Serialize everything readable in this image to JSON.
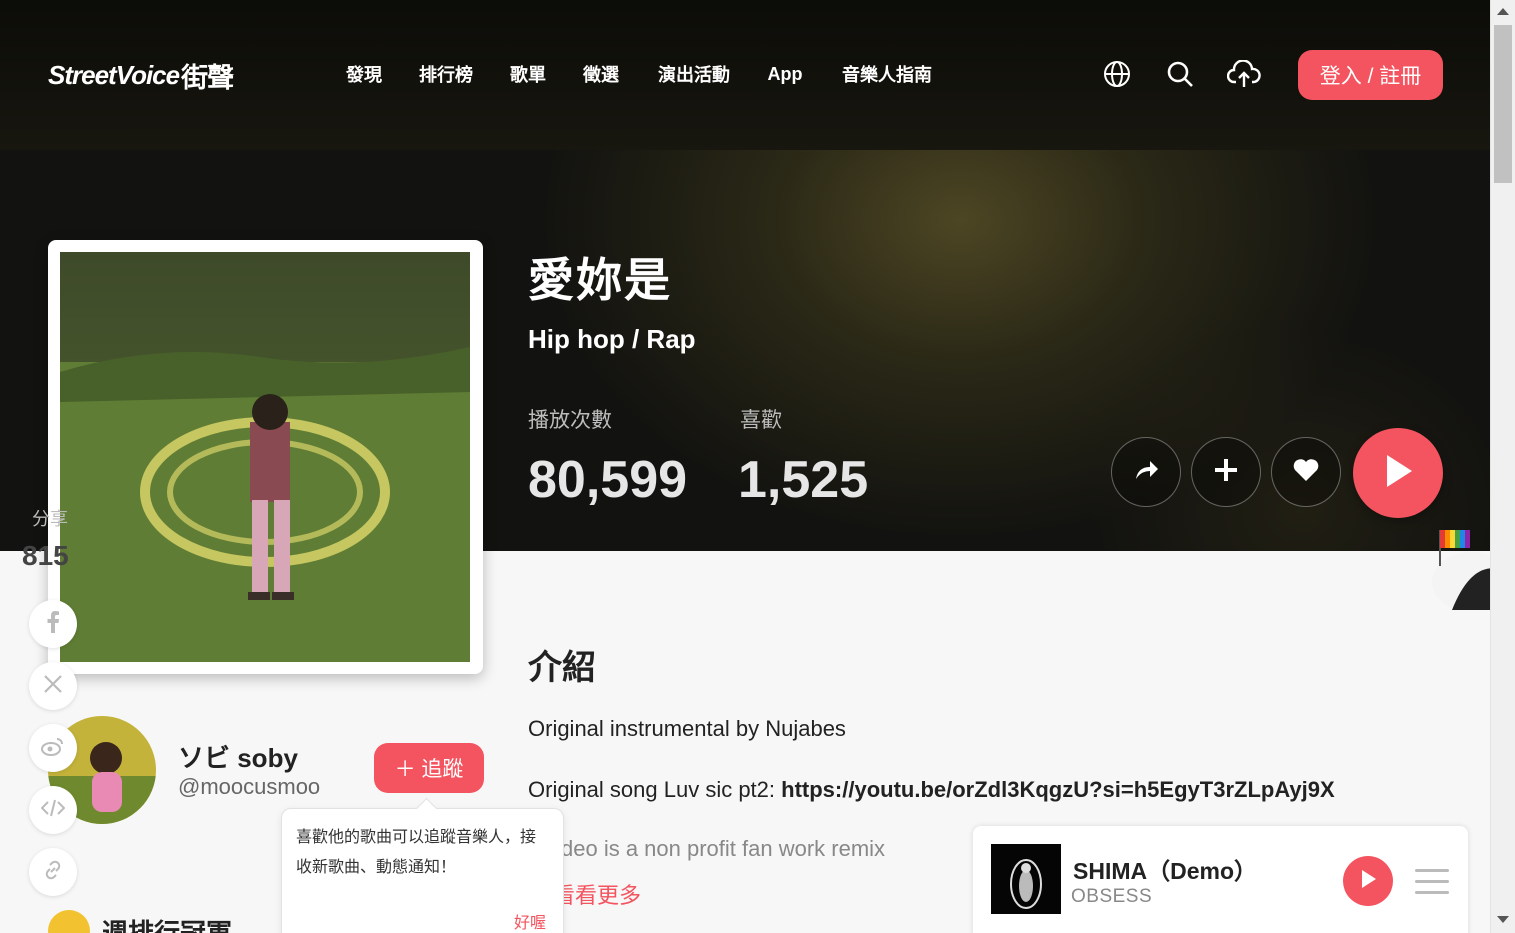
{
  "nav": {
    "logo_text": "StreetVoice",
    "logo_zh": "街聲",
    "items": [
      {
        "label": "發現"
      },
      {
        "label": "排行榜"
      },
      {
        "label": "歌單"
      },
      {
        "label": "徵選"
      },
      {
        "label": "演出活動"
      },
      {
        "label": "App"
      },
      {
        "label": "音樂人指南"
      }
    ],
    "icons": [
      "globe-icon",
      "search-icon",
      "upload-cloud-icon"
    ],
    "login_label": "登入 / 註冊"
  },
  "song": {
    "title": "愛妳是",
    "genre": "Hip hop / Rap",
    "plays_label": "播放次數",
    "plays_value": "80,599",
    "likes_label": "喜歡",
    "likes_value": "1,525"
  },
  "actions": [
    "share-icon",
    "add-icon",
    "heart-icon",
    "play-icon"
  ],
  "share": {
    "label": "分享",
    "count": "815",
    "buttons": [
      "facebook-icon",
      "x-icon",
      "weibo-icon",
      "embed-code-icon",
      "link-icon"
    ]
  },
  "artist": {
    "name": "ソビ soby",
    "handle": "@moocusmoo",
    "follow_label": "＋ 追蹤",
    "tooltip_text": "喜歡他的歌曲可以追蹤音樂人，接收新歌曲、動態通知！",
    "tooltip_ok": "好喔"
  },
  "weekly": {
    "label": "週排行冠軍"
  },
  "intro": {
    "heading": "介紹",
    "line1": "Original instrumental by Nujabes",
    "line2_prefix": "Original song Luv sic pt2: ",
    "line2_link": "https://youtu.be/orZdl3KqgzU?si=h5EgyT3rZLpAyj9X",
    "line3": "s video is a non profit fan work remix",
    "see_more": "看看更多"
  },
  "mini_player": {
    "title": "SHIMA（Demo）",
    "artist": "OBSESS"
  },
  "colors": {
    "accent": "#f3545f",
    "nav_bg": "#0c0c08"
  }
}
